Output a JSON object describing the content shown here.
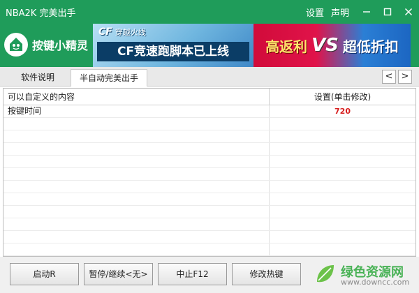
{
  "window": {
    "title": "NBA2K 完美出手",
    "settings_label": "设置",
    "statement_label": "声明",
    "minimize_icon": "minimize-icon",
    "maximize_icon": "maximize-icon",
    "close_icon": "close-icon",
    "accent_color": "#1f9c5a"
  },
  "brand": {
    "name": "按键小精灵",
    "icon": "sprite-logo-icon"
  },
  "banner": {
    "game_logo": "穿越火线",
    "headline": "CF竞速跑脚本已上线",
    "promo_left": "高返利",
    "vs": "VS",
    "promo_right": "超低折扣"
  },
  "tabs": [
    {
      "label": "软件说明",
      "active": false
    },
    {
      "label": "半自动完美出手",
      "active": true
    }
  ],
  "nav": {
    "prev": "<",
    "next": ">"
  },
  "table": {
    "headers": [
      "可以自定义的内容",
      "设置(单击修改)"
    ],
    "rows": [
      {
        "name": "按键时间",
        "value": "720"
      }
    ],
    "value_color": "#d71e1e"
  },
  "footer": {
    "buttons": [
      "启动R",
      "暂停/继续<无>",
      "中止F12",
      "修改热键"
    ]
  },
  "watermark": {
    "title": "绿色资源网",
    "url": "www.downcc.com"
  }
}
